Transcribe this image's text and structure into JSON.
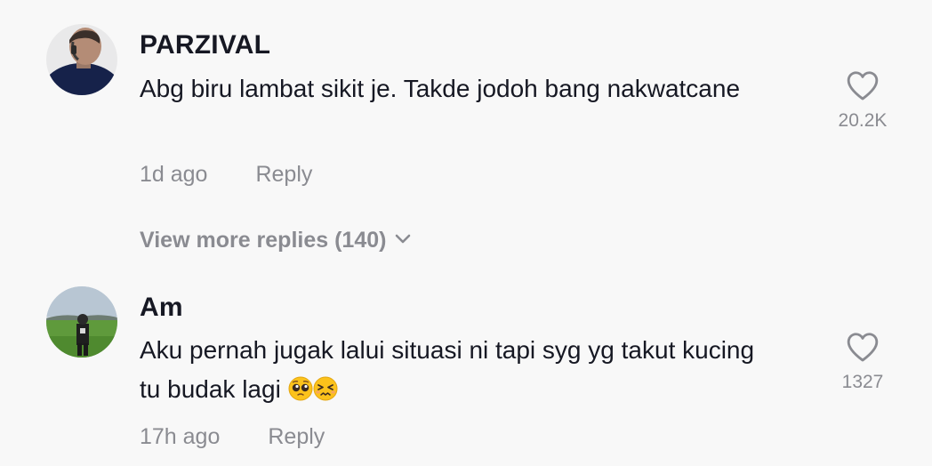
{
  "comments": [
    {
      "username": "PARZIVAL",
      "text": "Abg biru lambat sikit je. Takde jodoh bang nakwatcane",
      "time": "1d ago",
      "reply_label": "Reply",
      "like_count": "20.2K",
      "avatar": "avatar-photo-man-with-headset",
      "like_icon": "heart-outline-icon"
    },
    {
      "username": "Am",
      "text": "Aku pernah jugak lalui situasi ni tapi syg yg takut kucing tu budak lagi",
      "emojis": [
        "pleading-face-emoji",
        "persevering-face-emoji"
      ],
      "time": "17h ago",
      "reply_label": "Reply",
      "like_count": "1327",
      "avatar": "avatar-photo-person-in-field",
      "like_icon": "heart-outline-icon"
    }
  ],
  "view_more": {
    "label": "View more replies (140)",
    "icon": "chevron-down-icon"
  },
  "colors": {
    "background": "#f8f8f8",
    "text_primary": "#161823",
    "text_secondary": "#8a8b91"
  }
}
